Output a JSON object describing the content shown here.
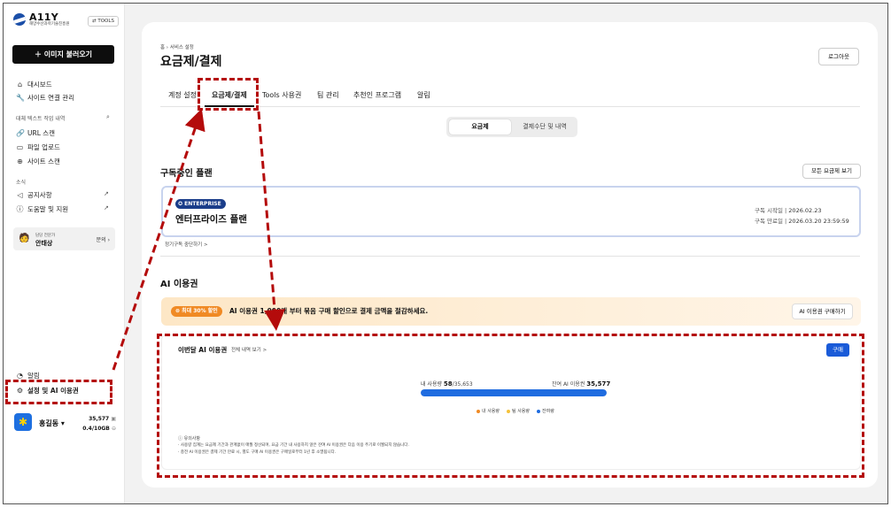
{
  "sidebar": {
    "logo_name": "A11Y",
    "logo_sub": "해양수산과학기술진흥원",
    "tools_label": "TOOLS",
    "import_label": "이미지 불러오기",
    "items": [
      {
        "label": "대시보드",
        "icon": "home-icon"
      },
      {
        "label": "사이트 연결 관리",
        "icon": "wrench-icon"
      }
    ],
    "section_history": "대체 텍스트 작업 내역",
    "history_items": [
      {
        "label": "URL 스캔",
        "icon": "link-icon"
      },
      {
        "label": "파일 업로드",
        "icon": "folder-icon"
      },
      {
        "label": "사이트 스캔",
        "icon": "globe-icon"
      }
    ],
    "section_news": "소식",
    "news_items": [
      {
        "label": "공지사항",
        "icon": "megaphone-icon"
      },
      {
        "label": "도움말 및 지원",
        "icon": "help-icon"
      }
    ],
    "expert_role": "담당 전문가",
    "expert_name": "안태상",
    "expert_ask": "문의",
    "notifications_label": "알림",
    "settings_label": "설정 및 AI 이용권",
    "user_name": "홍길동",
    "credits": "35,577",
    "storage": "0.4/10GB"
  },
  "main": {
    "breadcrumb": "홈 › 서비스 설정",
    "title": "요금제/결제",
    "logout_label": "로그아웃",
    "tabs": [
      "계정 설정",
      "요금제/결제",
      "Tools 사용권",
      "팀 관리",
      "추천인 프로그램",
      "알림"
    ],
    "segment": [
      "요금제",
      "결제수단 및 내역"
    ],
    "subscribed_title": "구독중인 플랜",
    "all_plans_label": "모든 요금제 보기",
    "plan_badge": "ENTERPRISE",
    "plan_name": "엔터프라이즈 플랜",
    "start_label": "구독 시작일",
    "start_date": "2026.02.23",
    "end_label": "구독 만료일",
    "end_date": "2026.03.20 23:59:59",
    "cancel_label": "정기구독 중단하기 >",
    "ai_title": "AI 이용권",
    "promo_badge": "최대 30% 할인",
    "promo_text": "AI 이용권 1,000개 부터 묶음 구매 할인으로 결제 금액을 절감하세요.",
    "promo_button": "AI 이용권 구매하기",
    "usage_title": "이번달 AI 이용권",
    "usage_history": "전체 내역 보기 >",
    "buy_label": "구매",
    "my_usage_label": "내 사용량",
    "my_usage_value": "58",
    "my_usage_total": "/35,653",
    "remaining_label": "잔여 AI 이용권",
    "remaining_value": "35,577",
    "usage_fraction": 0.998,
    "legend": [
      {
        "label": "내 사용량",
        "color": "#f08a24"
      },
      {
        "label": "팀 사용량",
        "color": "#f5c23a"
      },
      {
        "label": "잔여량",
        "color": "#1f6ce0"
      }
    ],
    "notes_head": "유의사항",
    "notes": [
      "사용량 집계는 요금제 기간과 관계없이 매월 정산되며, 요금 기간 내 사용하지 않은 잔여 AI 이용권은 다음 이용 주기로 이월되지 않습니다.",
      "충전 AI 이용권은 결제 기간 만료 시, 별도 구매 AI 이용권은 구매일로부터 1년 후 소멸됩니다."
    ]
  },
  "colors": {
    "accent": "#1a5bd8",
    "annotation": "#b40b0b",
    "badge": "#1a3d8a",
    "promo": "#f08a24"
  }
}
